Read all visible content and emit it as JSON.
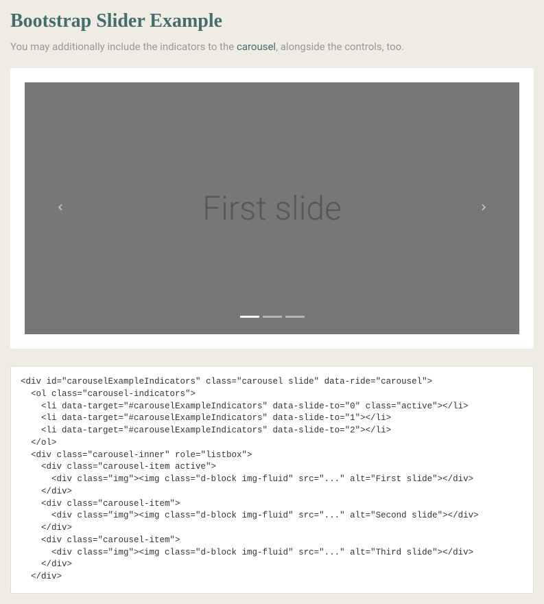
{
  "title": "Bootstrap Slider Example",
  "description": {
    "before": "You may additionally include the indicators to the ",
    "link": "carousel",
    "after": ", alongside the controls, too."
  },
  "carousel": {
    "slide_text": "First slide",
    "indicators_count": 3,
    "active_indicator": 0
  },
  "code": "<div id=\"carouselExampleIndicators\" class=\"carousel slide\" data-ride=\"carousel\">\n  <ol class=\"carousel-indicators\">\n    <li data-target=\"#carouselExampleIndicators\" data-slide-to=\"0\" class=\"active\"></li>\n    <li data-target=\"#carouselExampleIndicators\" data-slide-to=\"1\"></li>\n    <li data-target=\"#carouselExampleIndicators\" data-slide-to=\"2\"></li>\n  </ol>\n  <div class=\"carousel-inner\" role=\"listbox\">\n    <div class=\"carousel-item active\">\n      <div class=\"img\"><img class=\"d-block img-fluid\" src=\"...\" alt=\"First slide\"></div>\n    </div>\n    <div class=\"carousel-item\">\n      <div class=\"img\"><img class=\"d-block img-fluid\" src=\"...\" alt=\"Second slide\"></div>\n    </div>\n    <div class=\"carousel-item\">\n      <div class=\"img\"><img class=\"d-block img-fluid\" src=\"...\" alt=\"Third slide\"></div>\n    </div>\n  </div>"
}
